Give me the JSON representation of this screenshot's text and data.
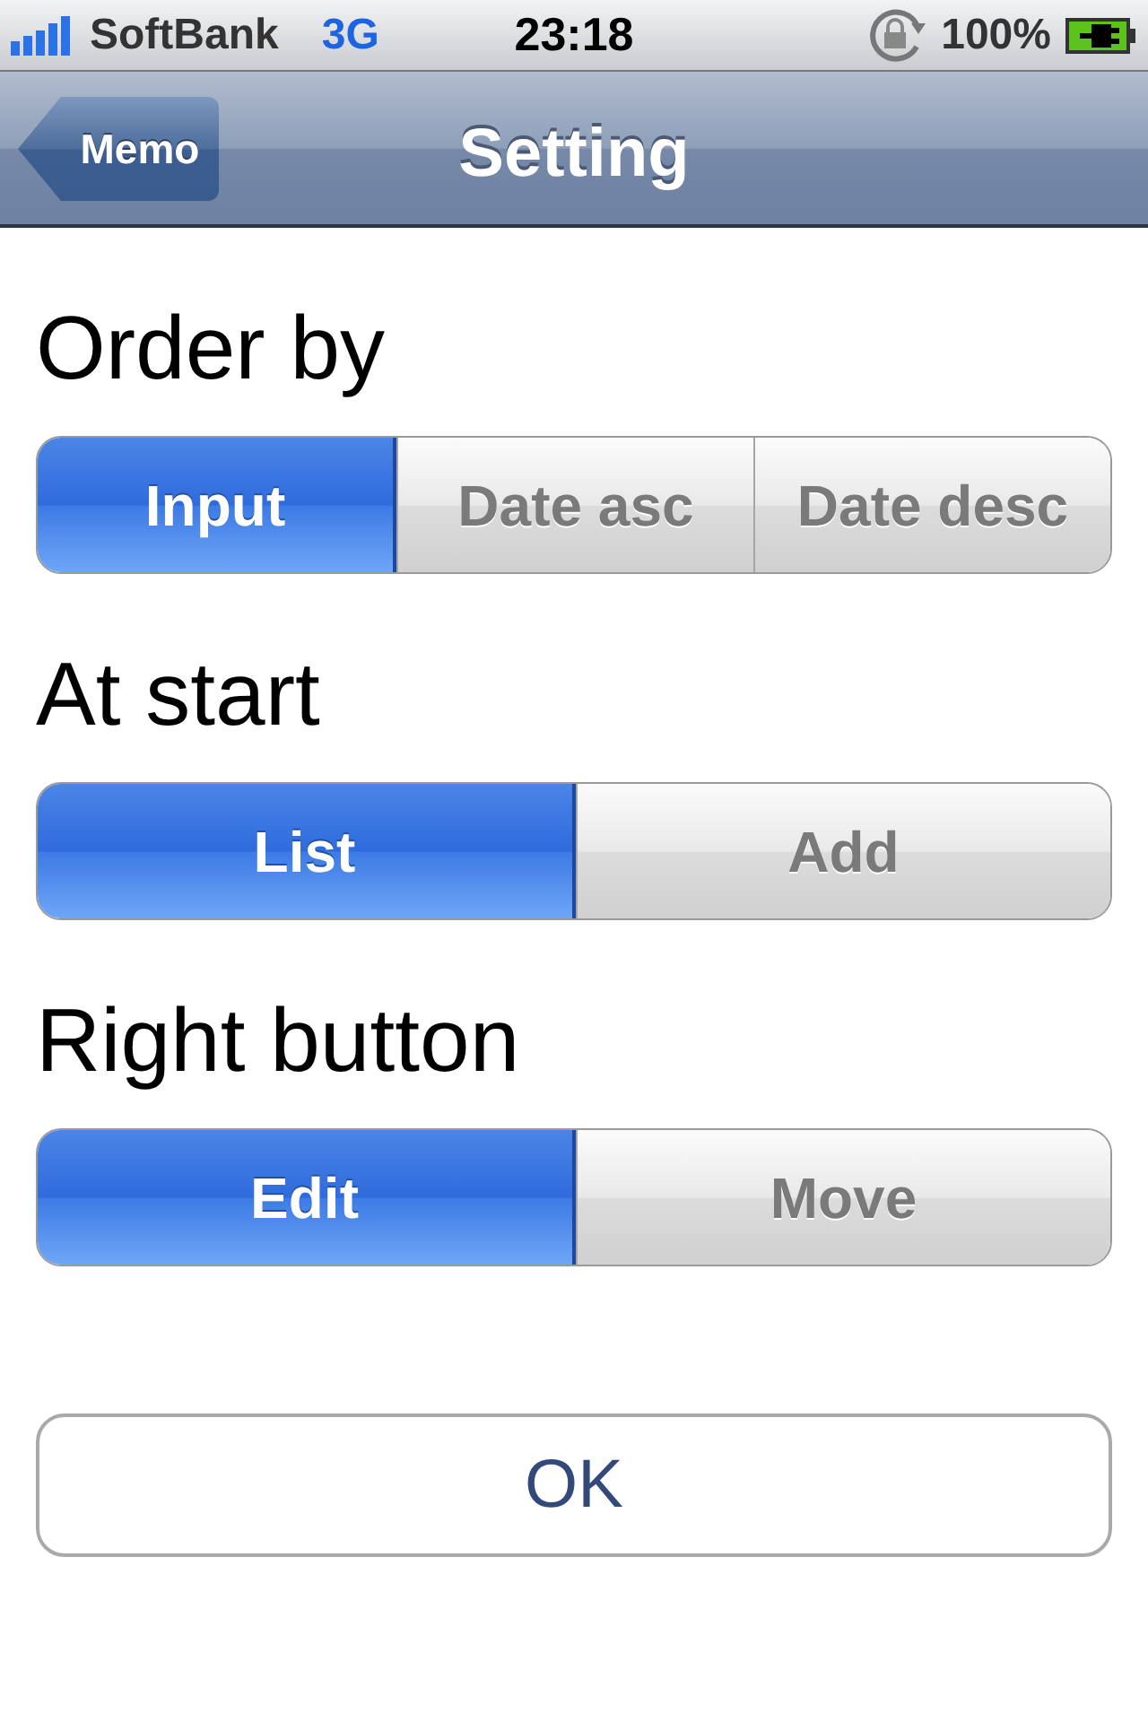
{
  "status_bar": {
    "carrier": "SoftBank",
    "network": "3G",
    "time": "23:18",
    "battery": "100%"
  },
  "nav_bar": {
    "back": "Memo",
    "title": "Setting"
  },
  "sections": [
    {
      "heading": "Order by",
      "options": [
        {
          "label": "Input",
          "selected": true
        },
        {
          "label": "Date asc",
          "selected": false
        },
        {
          "label": "Date desc",
          "selected": false
        }
      ]
    },
    {
      "heading": "At start",
      "options": [
        {
          "label": "List",
          "selected": true
        },
        {
          "label": "Add",
          "selected": false
        }
      ]
    },
    {
      "heading": "Right button",
      "options": [
        {
          "label": "Edit",
          "selected": true
        },
        {
          "label": "Move",
          "selected": false
        }
      ]
    }
  ],
  "ok_button": "OK"
}
